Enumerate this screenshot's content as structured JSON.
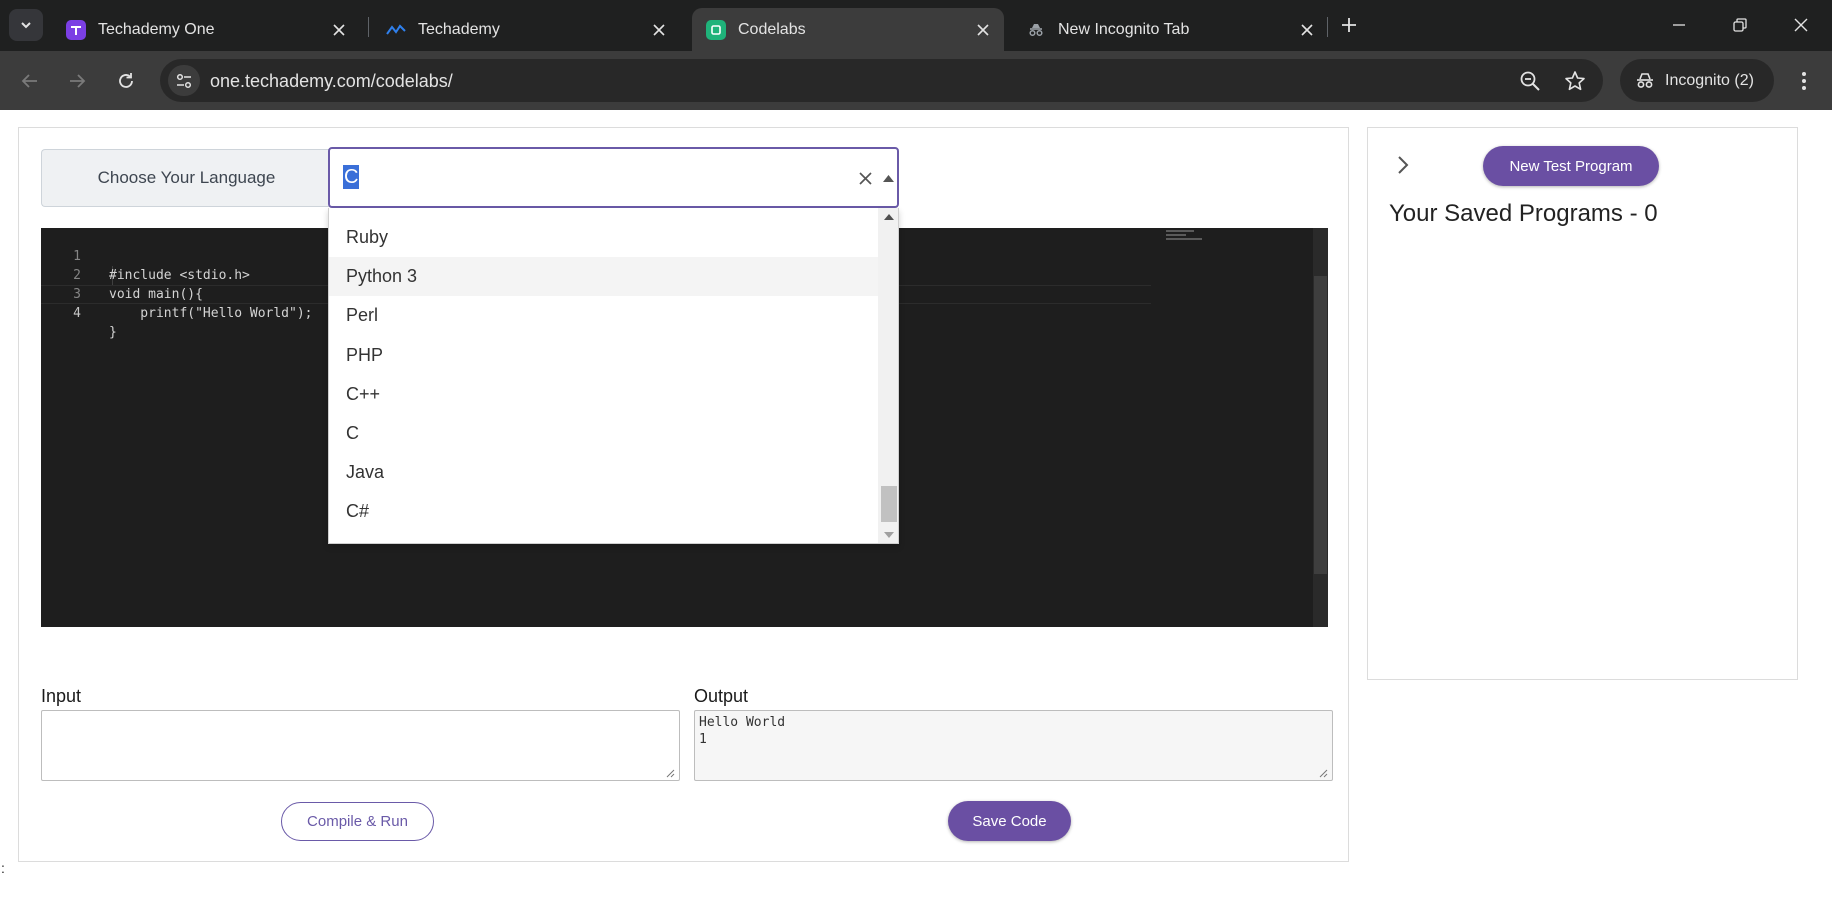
{
  "browser": {
    "tabs": [
      {
        "title": "Techademy One",
        "active": false
      },
      {
        "title": "Techademy",
        "active": false
      },
      {
        "title": "Codelabs",
        "active": true
      },
      {
        "title": "New Incognito Tab",
        "active": false
      }
    ],
    "url": "one.techademy.com/codelabs/",
    "incognito_label": "Incognito (2)"
  },
  "editor_panel": {
    "language_label": "Choose Your Language",
    "selected_language": "C",
    "language_options": [
      "Ruby",
      "Python 3",
      "Perl",
      "PHP",
      "C++",
      "C",
      "Java",
      "C#"
    ],
    "highlighted_option": "Python 3",
    "code_lines": [
      {
        "num": "1",
        "text": "#include <stdio.h>"
      },
      {
        "num": "2",
        "text": "void main(){"
      },
      {
        "num": "3",
        "text": "    printf(\"Hello World\");"
      },
      {
        "num": "4",
        "text": "}"
      }
    ],
    "input_label": "Input",
    "input_value": "",
    "output_label": "Output",
    "output_value": "Hello World\n1",
    "compile_button": "Compile & Run",
    "save_button": "Save Code"
  },
  "side_panel": {
    "new_program_button": "New Test Program",
    "saved_title": "Your Saved Programs - 0"
  },
  "stray_char": ":",
  "colors": {
    "accent": "#6a4fa3",
    "selection": "#3a6fd8",
    "editor_bg": "#1e1e1e",
    "chrome_bg": "#1f2020"
  }
}
